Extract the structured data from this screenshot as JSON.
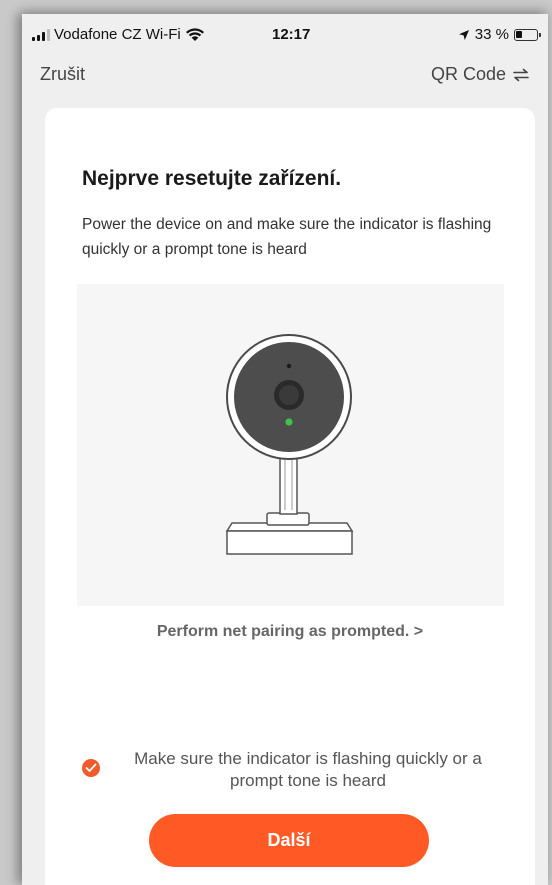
{
  "status_bar": {
    "carrier": "Vodafone CZ Wi-Fi",
    "time": "12:17",
    "battery_percent": "33 %",
    "battery_level": 0.33
  },
  "nav": {
    "cancel_label": "Zrušit",
    "qr_label": "QR Code",
    "qr_icon": "swap-arrows-icon"
  },
  "content": {
    "title": "Nejprve resetujte zařízení.",
    "description": "Power the device on and make sure the indicator is flashing quickly or a prompt tone is heard",
    "illustration": "security-camera",
    "pairing_link": "Perform net pairing as prompted. >",
    "confirm_text": "Make sure the indicator is flashing quickly or a prompt tone is heard",
    "confirm_checked": true,
    "next_label": "Další"
  },
  "colors": {
    "accent": "#ff5a25",
    "checkbox": "#ef5b2b",
    "indicator_led": "#3ec24a",
    "card_background": "#ffffff",
    "page_background": "#efefef"
  }
}
